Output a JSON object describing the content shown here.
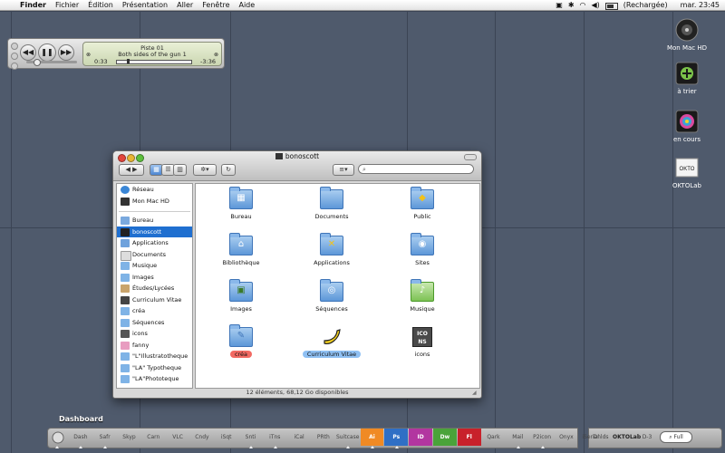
{
  "menubar": {
    "app_name": "Finder",
    "menus": [
      "Fichier",
      "Édition",
      "Présentation",
      "Aller",
      "Fenêtre",
      "Aide"
    ],
    "battery_status": "(Rechargée)",
    "clock": "mar. 23:45"
  },
  "player": {
    "track_label": "Piste 01",
    "track_title": "Both sides of the gun 1",
    "elapsed": "0:33",
    "remaining": "-3:36",
    "progress": 0.13
  },
  "desktop_icons": [
    "Mon Mac HD",
    "à trier",
    "en cours",
    "OKTOLab"
  ],
  "finder": {
    "title": "bonoscott",
    "search_placeholder": "",
    "sidebar": {
      "devices": [
        "Réseau",
        "Mon Mac HD"
      ],
      "places": [
        "Bureau",
        "bonoscott",
        "Applications",
        "Documents",
        "Musique",
        "Images",
        "Études/Lycées",
        "Curriculum Vitae",
        "créa",
        "Séquences",
        "icons",
        "fanny",
        "\"L\"Illustratotheque",
        "\"LA\" Typotheque",
        "\"LA\"Phototeque"
      ],
      "selected": "bonoscott"
    },
    "items": [
      {
        "name": "Bureau",
        "icon": "desktop-folder"
      },
      {
        "name": "Documents",
        "icon": "documents-folder"
      },
      {
        "name": "Public",
        "icon": "public-folder"
      },
      {
        "name": "Bibliothèque",
        "icon": "library-folder"
      },
      {
        "name": "Applications",
        "icon": "applications-folder"
      },
      {
        "name": "Sites",
        "icon": "sites-folder"
      },
      {
        "name": "Images",
        "icon": "pictures-folder"
      },
      {
        "name": "Séquences",
        "icon": "movies-folder"
      },
      {
        "name": "Musique",
        "icon": "music-folder"
      },
      {
        "name": "créa",
        "icon": "crea-folder",
        "label_color": "red"
      },
      {
        "name": "Curriculum Vitae",
        "icon": "banana",
        "label_color": "blue"
      },
      {
        "name": "icons",
        "icon": "icons-box"
      }
    ],
    "status": "12 éléments, 68,12 Go disponibles"
  },
  "dock": {
    "label": "Dashboard",
    "items": [
      "Dash",
      "Safr",
      "Skyp",
      "Carn",
      "VLC",
      "Cndy",
      "iSqt",
      "Snti",
      "iTns",
      "iCal",
      "PRth",
      "Suitcase",
      "Ai",
      "Ps",
      "ID",
      "Dw",
      "Fl",
      "Qark",
      "Mail",
      "P2icon",
      "Onyx",
      "iSerial"
    ],
    "right_items": [
      "Dnlds",
      "OKTOLab",
      "D-3"
    ],
    "search_label": "Full",
    "colors": {
      "Ai": "#f08a24",
      "Ps": "#2f6fc5",
      "ID": "#b236a0",
      "Dw": "#4aa33a",
      "Fl": "#c8212b"
    }
  }
}
